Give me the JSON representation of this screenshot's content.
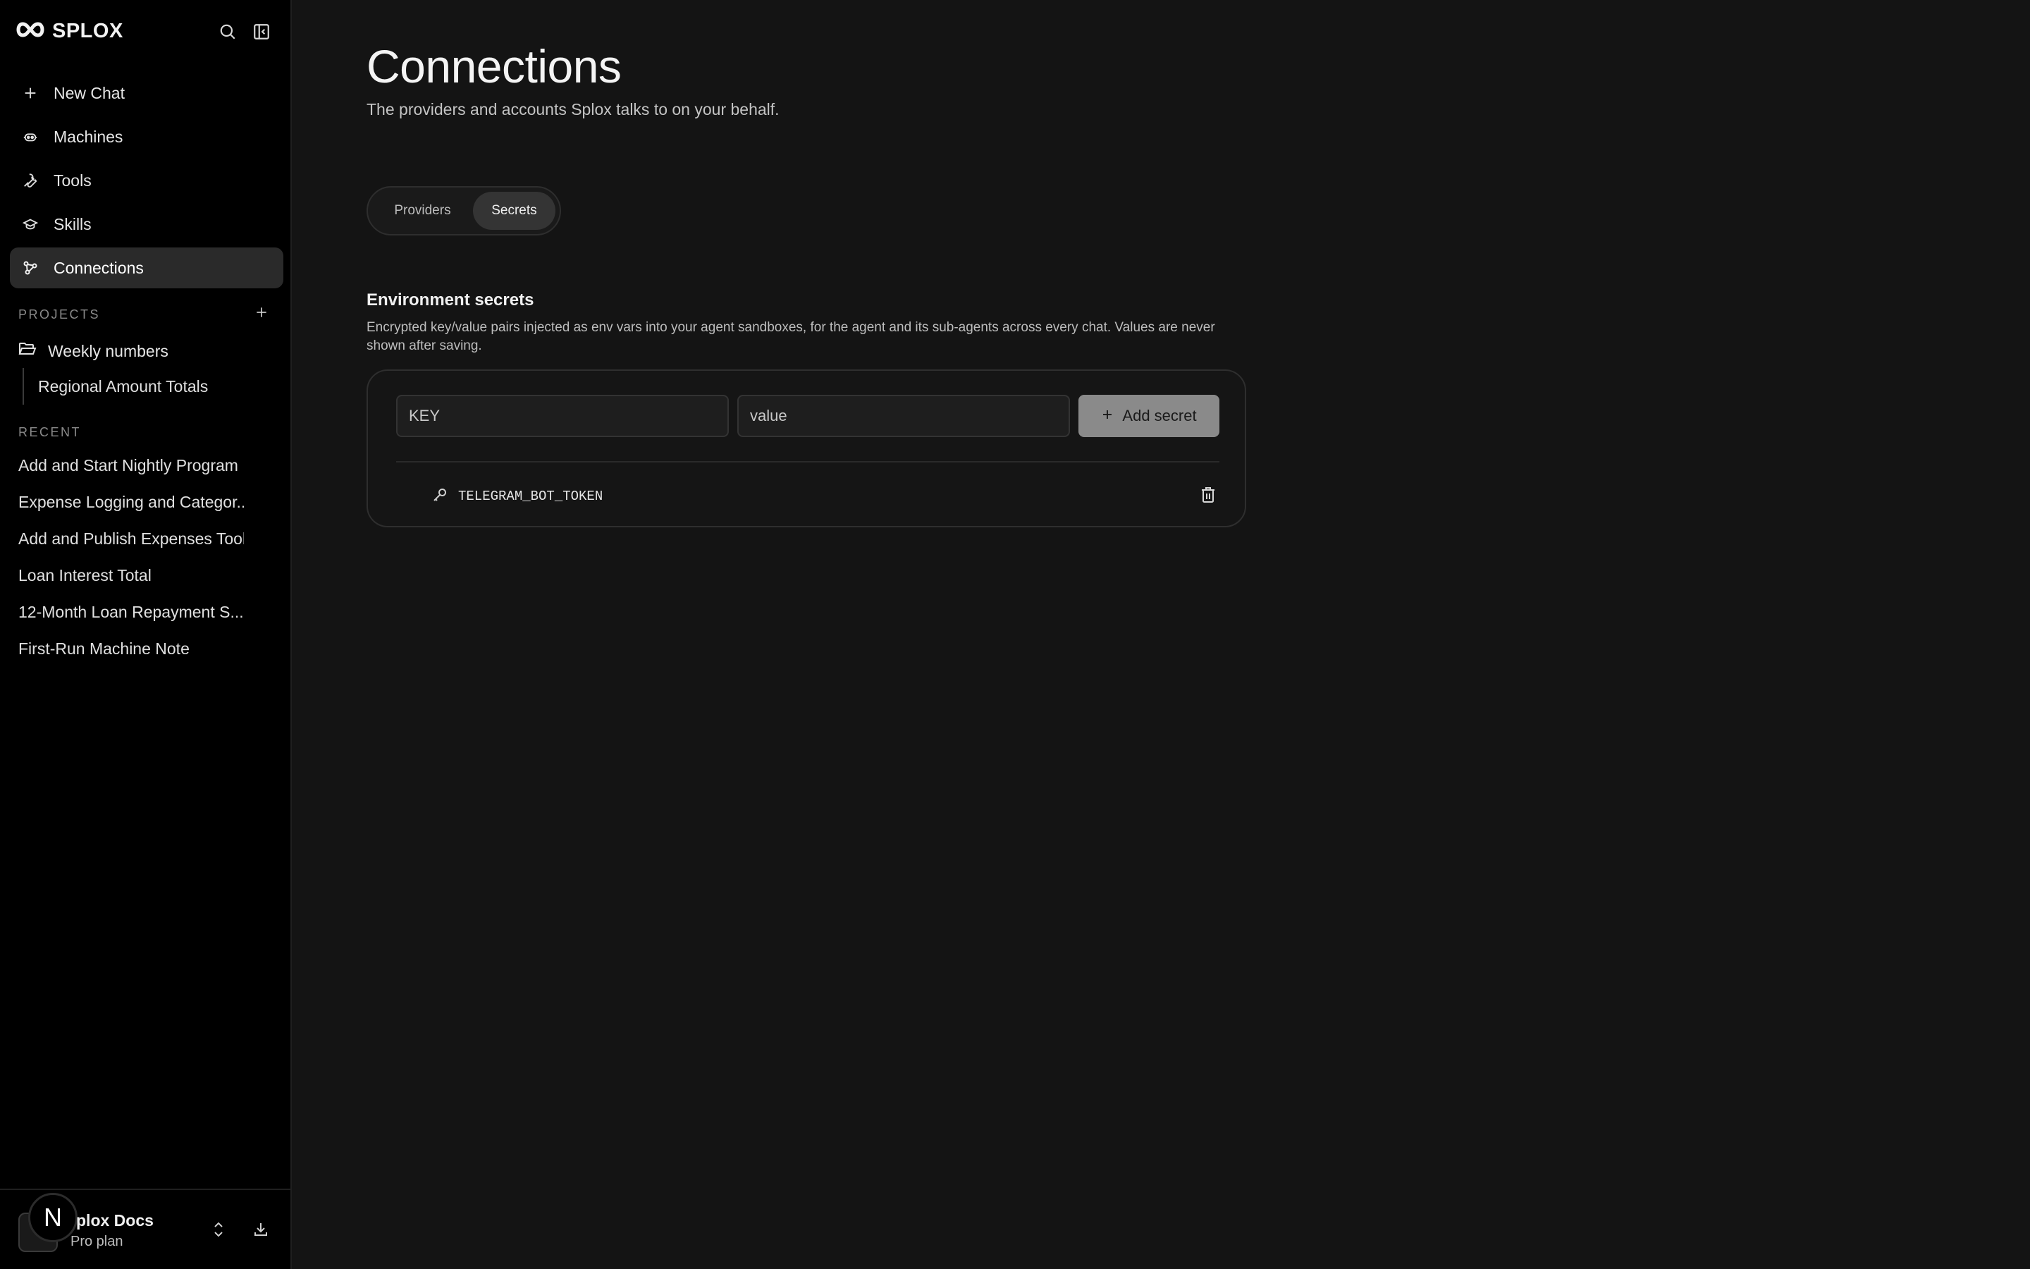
{
  "brand": {
    "name": "SPLOX"
  },
  "nav": {
    "items": [
      {
        "label": "New Chat",
        "icon": "plus-icon"
      },
      {
        "label": "Machines",
        "icon": "robot-icon"
      },
      {
        "label": "Tools",
        "icon": "wrench-icon"
      },
      {
        "label": "Skills",
        "icon": "graduation-cap-icon"
      },
      {
        "label": "Connections",
        "icon": "connections-icon",
        "active": true
      }
    ]
  },
  "projects": {
    "label": "PROJECTS",
    "items": [
      {
        "label": "Weekly numbers",
        "icon": "folder-open-icon"
      }
    ],
    "sub_items": [
      {
        "label": "Regional Amount Totals"
      }
    ]
  },
  "recent": {
    "label": "RECENT",
    "items": [
      "Add and Start Nightly Program",
      "Expense Logging and Categor...",
      "Add and Publish Expenses Tool",
      "Loan Interest Total",
      "12-Month Loan Repayment S...",
      "First-Run Machine Note"
    ]
  },
  "workspace": {
    "name": "plox Docs",
    "plan": "Pro plan",
    "badge": "N"
  },
  "page": {
    "title": "Connections",
    "subtitle": "The providers and accounts Splox talks to on your behalf."
  },
  "tabs": [
    {
      "label": "Providers",
      "active": false
    },
    {
      "label": "Secrets",
      "active": true
    }
  ],
  "secrets": {
    "heading": "Environment secrets",
    "description": "Encrypted key/value pairs injected as env vars into your agent sandboxes, for the agent and its sub-agents across every chat. Values are never shown after saving.",
    "key_placeholder": "KEY",
    "value_placeholder": "value",
    "add_label": "Add secret",
    "items": [
      {
        "key": "TELEGRAM_BOT_TOKEN"
      }
    ]
  },
  "colors": {
    "background": "#141414",
    "sidebar": "#000000",
    "active_nav": "#2a2a2a",
    "add_button": "#8a8a8a"
  }
}
